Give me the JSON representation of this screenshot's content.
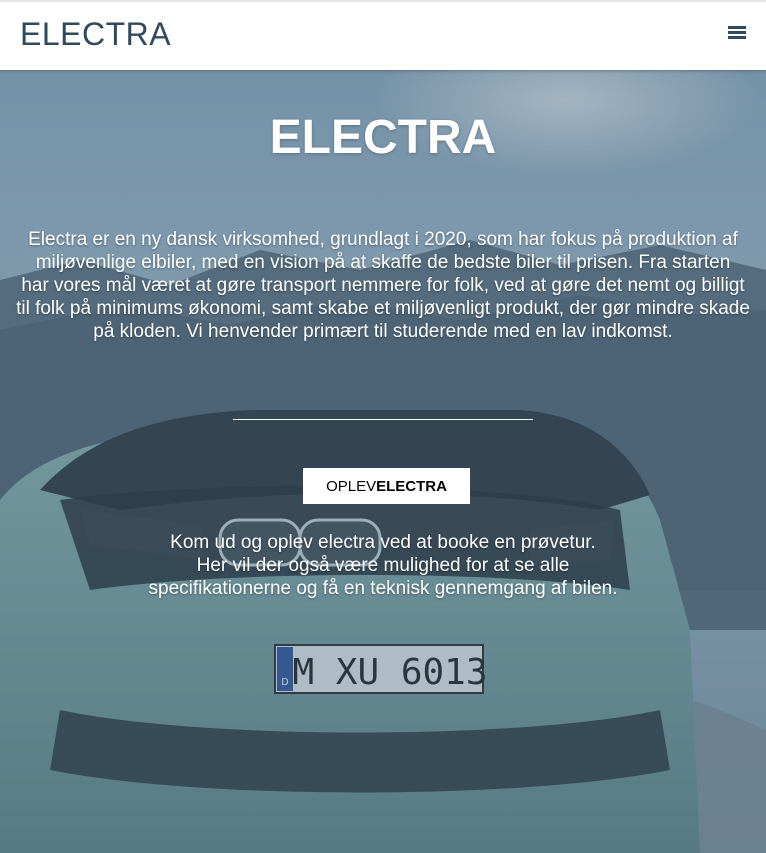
{
  "navbar": {
    "brand": "ELECTRA",
    "menu_icon": "hamburger-menu-icon"
  },
  "hero": {
    "title": "ELECTRA",
    "intro_lines": [
      "Electra er en ny dansk virksomhed, grundlagt i 2020, som har fokus på produktion af",
      "miljøvenlige elbiler, med en vision på at skaffe de bedste biler til prisen. Fra starten",
      "har vores mål været at gøre transport nemmere for folk, ved at gøre det nemt og billigt til folk på minimums økonomi, samt skabe et miljøvenligt produkt, der gør mindre skade på kloden. Vi henvender primært til studerende med en lav indkomst."
    ],
    "cta_prefix": "OPLEV",
    "cta_bold": "ELECTRA",
    "sub_lines": [
      "Kom ud og oplev electra ved at booke en prøvetur.",
      "Her vil der også være mulighed for at se alle",
      "specifikationerne og få en teknisk gennemgang af bilen."
    ],
    "license_plate": "M XU 6013",
    "plate_country": "D"
  },
  "colors": {
    "brand_text": "#2e4a5c",
    "navbar_bg": "#ffffff",
    "hero_overlay": "#4a6a82",
    "hero_text": "#ffffff",
    "car_body": "#7fa8a8"
  }
}
